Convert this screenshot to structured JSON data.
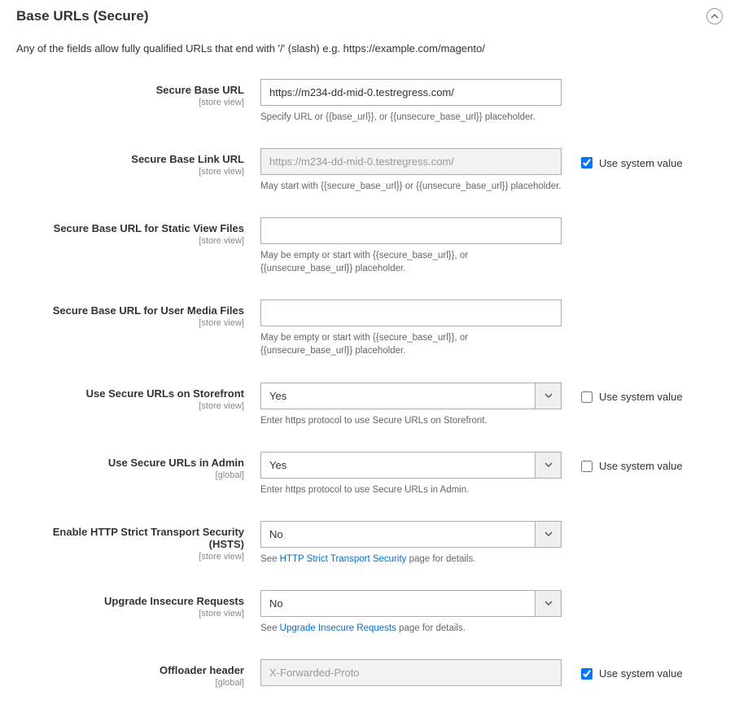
{
  "section": {
    "title": "Base URLs (Secure)",
    "description": "Any of the fields allow fully qualified URLs that end with '/' (slash) e.g. https://example.com/magento/"
  },
  "scopes": {
    "store_view": "[store view]",
    "global": "[global]"
  },
  "use_system_label": "Use system value",
  "fields": {
    "secure_base_url": {
      "label": "Secure Base URL",
      "value": "https://m234-dd-mid-0.testregress.com/",
      "hint": "Specify URL or {{base_url}}, or {{unsecure_base_url}} placeholder."
    },
    "secure_base_link_url": {
      "label": "Secure Base Link URL",
      "value": "https://m234-dd-mid-0.testregress.com/",
      "hint": "May start with {{secure_base_url}} or {{unsecure_base_url}} placeholder."
    },
    "secure_base_static": {
      "label": "Secure Base URL for Static View Files",
      "value": "",
      "hint": "May be empty or start with {{secure_base_url}}, or {{unsecure_base_url}} placeholder."
    },
    "secure_base_media": {
      "label": "Secure Base URL for User Media Files",
      "value": "",
      "hint": "May be empty or start with {{secure_base_url}}, or {{unsecure_base_url}} placeholder."
    },
    "use_secure_storefront": {
      "label": "Use Secure URLs on Storefront",
      "value": "Yes",
      "hint": "Enter https protocol to use Secure URLs on Storefront."
    },
    "use_secure_admin": {
      "label": "Use Secure URLs in Admin",
      "value": "Yes",
      "hint": "Enter https protocol to use Secure URLs in Admin."
    },
    "hsts": {
      "label": "Enable HTTP Strict Transport Security (HSTS)",
      "value": "No",
      "hint_pre": "See ",
      "hint_link": "HTTP Strict Transport Security",
      "hint_post": " page for details."
    },
    "upgrade_insecure": {
      "label": "Upgrade Insecure Requests",
      "value": "No",
      "hint_pre": "See ",
      "hint_link": "Upgrade Insecure Requests",
      "hint_post": " page for details."
    },
    "offloader": {
      "label": "Offloader header",
      "value": "X-Forwarded-Proto"
    }
  }
}
